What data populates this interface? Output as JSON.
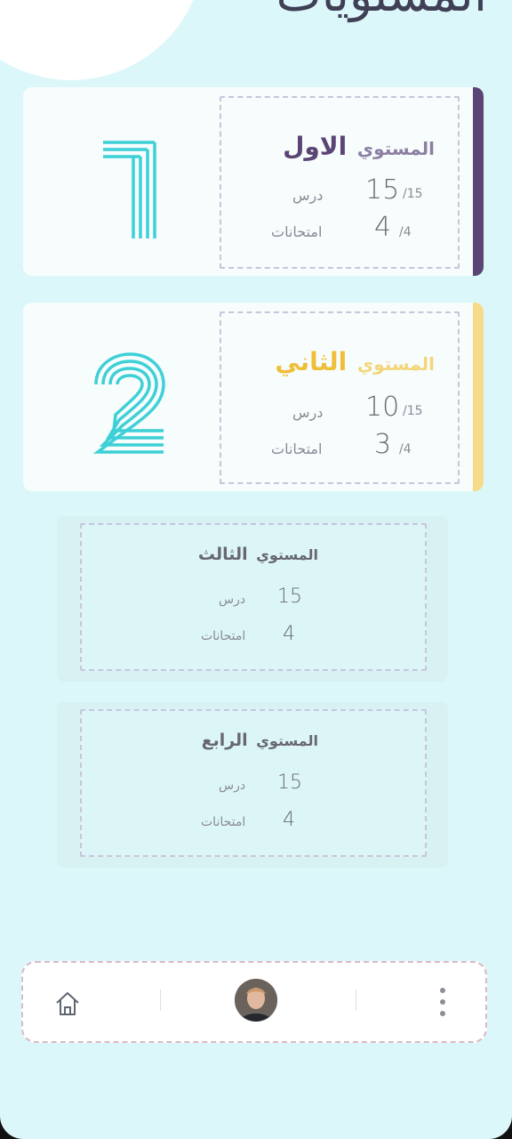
{
  "header": {
    "title": "المستويات"
  },
  "levels": [
    {
      "prefix": "المستوي",
      "name": "الاول",
      "number": "1",
      "lessons_done": "15",
      "lessons_total": "/15",
      "lessons_label": "درس",
      "exams_done": "4",
      "exams_total": "/4",
      "exams_label": "امتحانات",
      "prefix_color": "#8b7fa2",
      "name_color": "#5a4575",
      "edge_color": "#5a4575"
    },
    {
      "prefix": "المستوي",
      "name": "الثاني",
      "number": "2",
      "lessons_done": "10",
      "lessons_total": "/15",
      "lessons_label": "درس",
      "exams_done": "3",
      "exams_total": "/4",
      "exams_label": "امتحانات",
      "prefix_color": "#f3d67a",
      "name_color": "#f0bf3a",
      "edge_color": "#f6dc8a"
    },
    {
      "prefix": "المستوي",
      "name": "الثالث",
      "lessons": "15",
      "lessons_label": "درس",
      "exams": "4",
      "exams_label": "امتحانات"
    },
    {
      "prefix": "المستوي",
      "name": "الرابع",
      "lessons": "15",
      "lessons_label": "درس",
      "exams": "4",
      "exams_label": "امتحانات"
    }
  ],
  "colors": {
    "numeral": "#3dd0d6",
    "background": "#dcf7f9"
  },
  "nav": {
    "home_icon": "home-icon",
    "profile_icon": "avatar",
    "more_icon": "more-vertical-icon"
  }
}
